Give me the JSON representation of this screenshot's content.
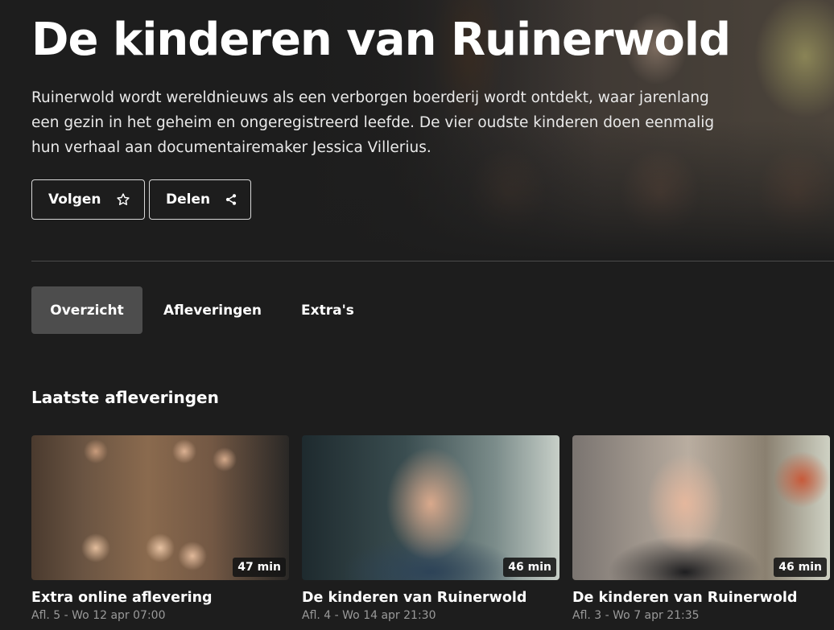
{
  "hero": {
    "title": "De kinderen van Ruinerwold",
    "description": "Ruinerwold wordt wereldnieuws als een verborgen boerderij wordt ontdekt, waar jarenlang een gezin in het geheim en ongeregistreerd leefde. De vier oudste kinderen doen eenmalig hun verhaal aan documentairemaker Jessica Villerius.",
    "follow_label": "Volgen",
    "follow_icon": "star-icon",
    "share_label": "Delen",
    "share_icon": "share-icon"
  },
  "tabs": [
    {
      "label": "Overzicht",
      "selected": true
    },
    {
      "label": "Afleveringen",
      "selected": false
    },
    {
      "label": "Extra's",
      "selected": false
    }
  ],
  "section": {
    "title": "Laatste afleveringen"
  },
  "episodes": [
    {
      "title": "Extra online aflevering",
      "meta": "Afl. 5 - Wo 12 apr 07:00",
      "duration": "47 min"
    },
    {
      "title": "De kinderen van Ruinerwold",
      "meta": "Afl. 4 - Wo 14 apr 21:30",
      "duration": "46 min"
    },
    {
      "title": "De kinderen van Ruinerwold",
      "meta": "Afl. 3 - Wo 7 apr 21:35",
      "duration": "46 min"
    }
  ],
  "colors": {
    "background": "#1d1d1d",
    "selected_tab": "#4d4d4d",
    "meta_text": "#9a9a9a"
  }
}
